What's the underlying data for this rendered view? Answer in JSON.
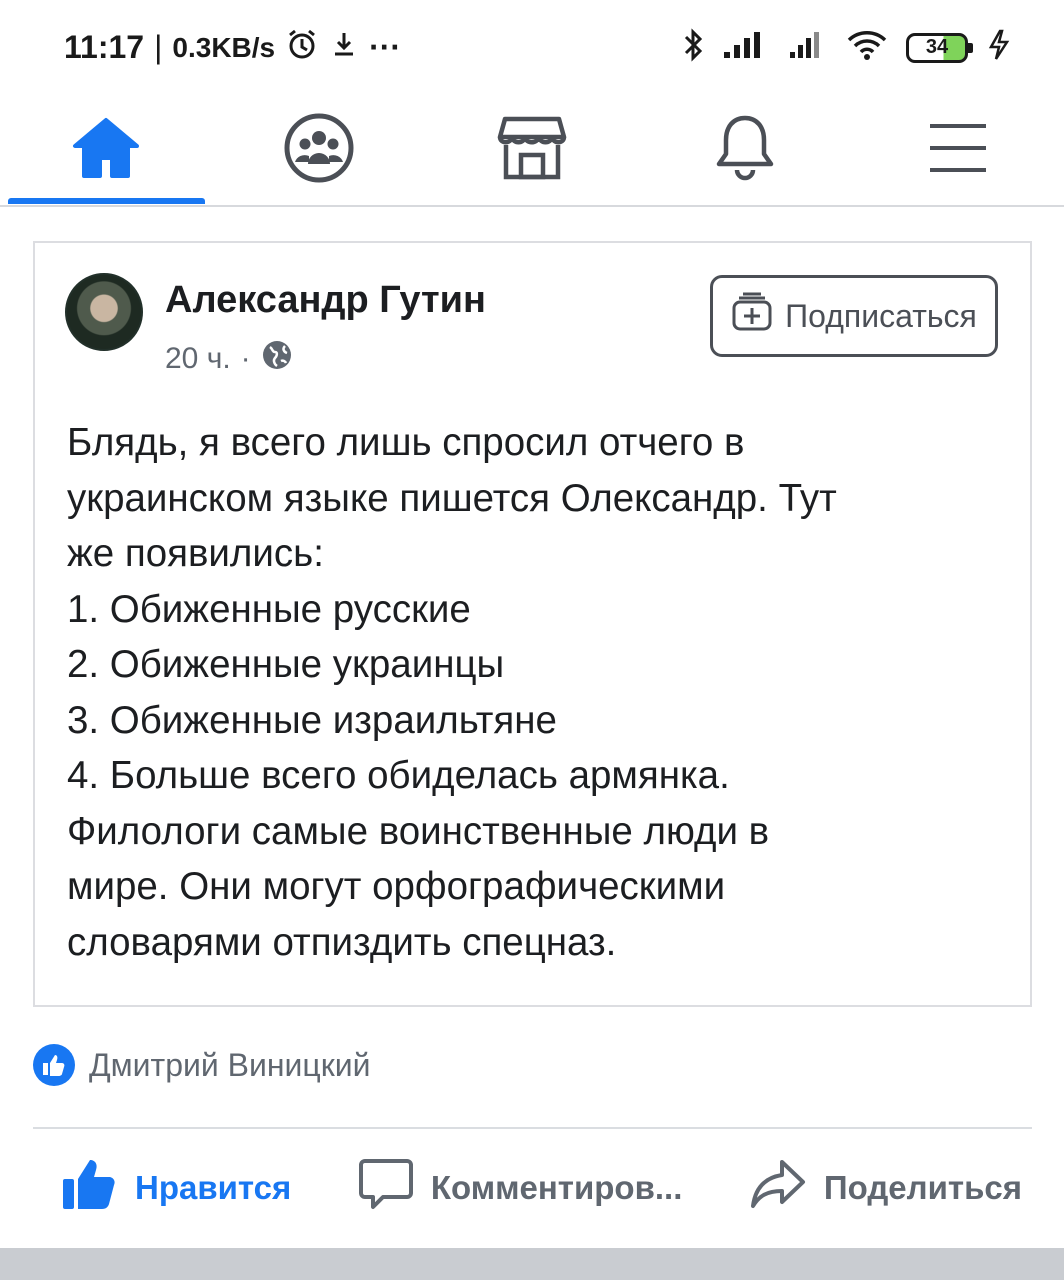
{
  "status_bar": {
    "time": "11:17",
    "separator": "|",
    "net_speed": "0.3KB/s",
    "more": "···",
    "battery": "34",
    "icons": [
      "alarm-icon",
      "download-icon",
      "bluetooth-icon",
      "signal-icon",
      "wifi-icon",
      "battery-icon",
      "charging-icon"
    ]
  },
  "nav": {
    "items": [
      {
        "name": "home",
        "icon": "home-icon",
        "active": true
      },
      {
        "name": "groups",
        "icon": "groups-icon",
        "active": false
      },
      {
        "name": "marketplace",
        "icon": "marketplace-icon",
        "active": false
      },
      {
        "name": "notifications",
        "icon": "bell-icon",
        "active": false
      },
      {
        "name": "menu",
        "icon": "menu-icon",
        "active": false
      }
    ],
    "accent": "#1877f2"
  },
  "post": {
    "author": "Александр Гутин",
    "time": "20 ч.",
    "dot": "·",
    "audience_icon": "globe-icon",
    "follow_label": "Подписаться",
    "lines": [
      "Блядь, я всего лишь спросил отчего в",
      "украинском языке пишется Олександр. Тут",
      "же появились:",
      "1. Обиженные русские",
      "2. Обиженные украинцы",
      "3. Обиженные израильтяне",
      "4. Больше всего обиделась армянка.",
      "Филологи самые воинственные люди в",
      "мире. Они могут орфографическими",
      "словарями отпиздить спецназ."
    ]
  },
  "reactions": {
    "icon": "like-badge-icon",
    "names": "Дмитрий Виницкий"
  },
  "actions": {
    "like": "Нравится",
    "comment": "Комментиров...",
    "share": "Поделиться"
  }
}
